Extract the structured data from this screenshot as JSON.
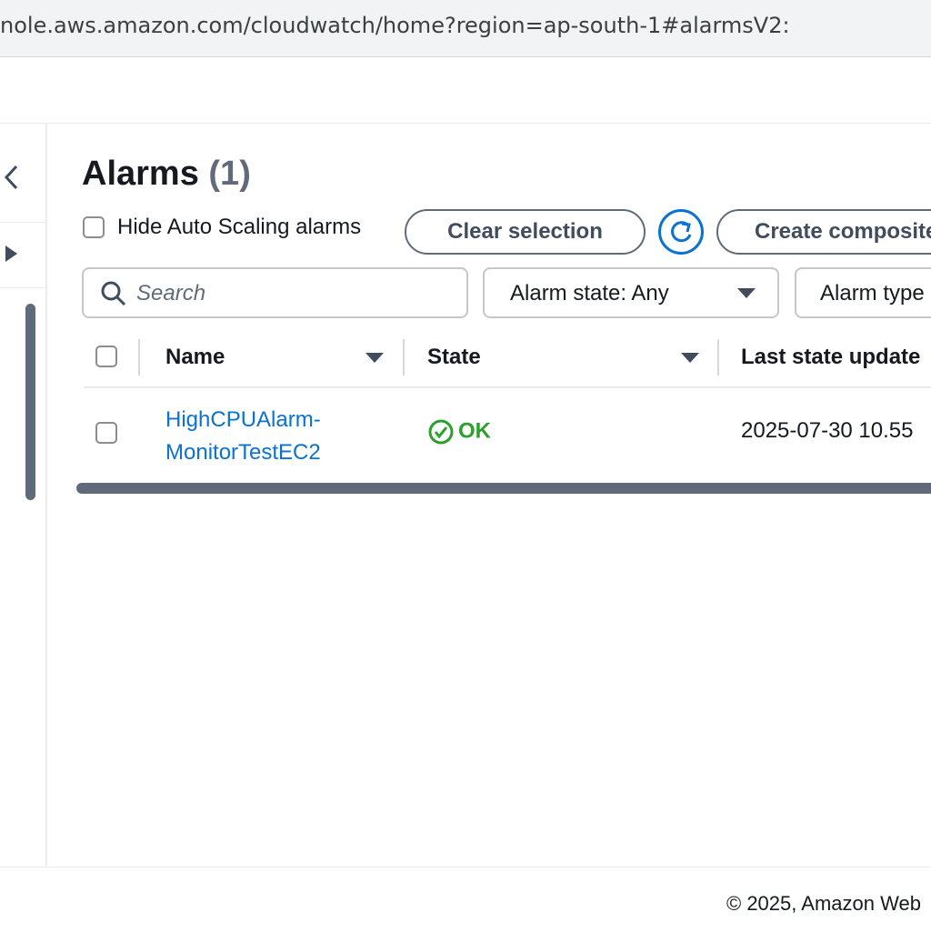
{
  "browser": {
    "url": "nole.aws.amazon.com/cloudwatch/home?region=ap-south-1#alarmsV2:"
  },
  "page": {
    "title": "Alarms",
    "count": "(1)"
  },
  "toolbar": {
    "hide_autoscaling_label": "Hide Auto Scaling alarms",
    "hide_autoscaling_checked": false,
    "clear_selection_label": "Clear selection",
    "refresh_icon": "refresh-icon",
    "create_composite_label": "Create composite"
  },
  "filters": {
    "search_placeholder": "Search",
    "alarm_state": "Alarm state: Any",
    "alarm_type": "Alarm type"
  },
  "table": {
    "columns": [
      "Name",
      "State",
      "Last state update"
    ],
    "rows": [
      {
        "name_line1": "HighCPUAlarm-",
        "name_line2": "MonitorTestEC2",
        "state": "OK",
        "last_update": "2025-07-30 10.55"
      }
    ]
  },
  "colors": {
    "link": "#0972d3",
    "ok": "#2ba02b",
    "text": "#16191f"
  },
  "footer": {
    "copyright": "© 2025, Amazon Web"
  }
}
